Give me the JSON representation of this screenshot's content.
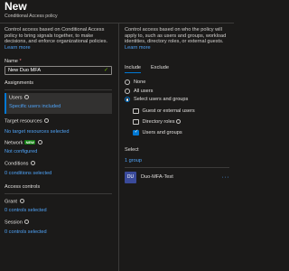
{
  "header": {
    "title": "New",
    "subtitle": "Conditional Access policy"
  },
  "left": {
    "description": "Control access based on Conditional Access policy to bring signals together, to make decisions, and enforce organizational policies.",
    "learn_more": "Learn more",
    "name_label": "Name",
    "name_required": "*",
    "name_value": "New Duo MFA",
    "assignments_heading": "Assignments",
    "users_label": "Users",
    "users_value": "Specific users included",
    "target_label": "Target resources",
    "target_value": "No target resources selected",
    "network_label": "Network",
    "network_badge": "NEW",
    "network_value": "Not configured",
    "conditions_label": "Conditions",
    "conditions_value": "0 conditions selected",
    "access_controls_heading": "Access controls",
    "grant_label": "Grant",
    "grant_value": "0 controls selected",
    "session_label": "Session",
    "session_value": "0 controls selected"
  },
  "right": {
    "description": "Control access based on who the policy will apply to, such as users and groups, workload identities, directory roles, or external guests.",
    "learn_more": "Learn more",
    "tabs": [
      "Include",
      "Exclude"
    ],
    "radio_options": [
      "None",
      "All users",
      "Select users and groups"
    ],
    "checkbox_options": [
      "Guest or external users",
      "Directory roles",
      "Users and groups"
    ],
    "checkbox_states": [
      false,
      false,
      true
    ],
    "select_heading": "Select",
    "select_count": "1 group",
    "selected_item": {
      "initials": "DU",
      "name": "Duo-MFA-Test",
      "more": "···"
    }
  },
  "colors": {
    "background": "#1b1a19",
    "accent": "#0078d4",
    "link": "#4fa3f7",
    "new_badge": "#107c10",
    "avatar": "#3a4a9a"
  },
  "icons": [
    "info-icon",
    "checkmark-icon",
    "more-icon"
  ]
}
